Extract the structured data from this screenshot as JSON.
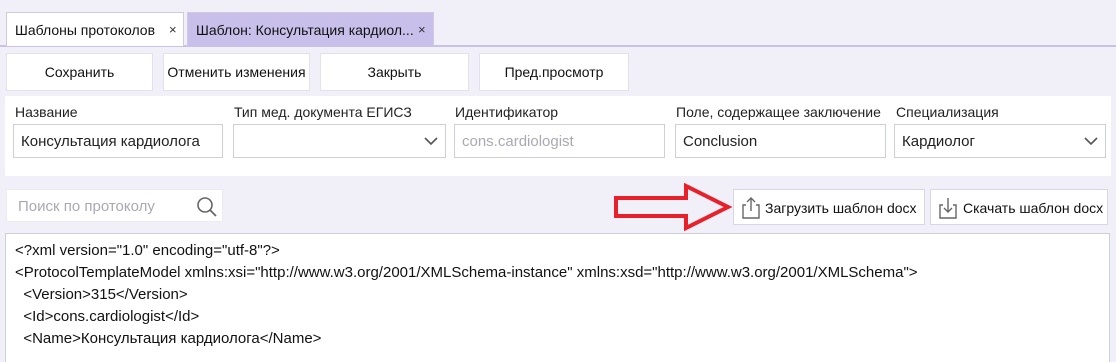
{
  "tabs": [
    {
      "label": "Шаблоны протоколов",
      "close": "×"
    },
    {
      "label": "Шаблон: Консультация кардиол...",
      "close": "×"
    }
  ],
  "toolbar": {
    "save": "Сохранить",
    "revert": "Отменить изменения",
    "close": "Закрыть",
    "preview": "Пред.просмотр"
  },
  "form": {
    "name": {
      "label": "Название",
      "value": "Консультация кардиолога"
    },
    "doc_type": {
      "label": "Тип мед. документа ЕГИСЗ",
      "value": ""
    },
    "identifier": {
      "label": "Идентификатор",
      "placeholder": "cons.cardiologist"
    },
    "conclusion_field": {
      "label": "Поле, содержащее заключение",
      "value": "Conclusion"
    },
    "specialization": {
      "label": "Специализация",
      "value": "Кардиолог"
    }
  },
  "search": {
    "placeholder": "Поиск по протоколу"
  },
  "actions": {
    "upload": "Загрузить шаблон docx",
    "download": "Скачать шаблон docx"
  },
  "annotation_color": "#e8202a",
  "editor": {
    "lines": [
      "<?xml version=\"1.0\" encoding=\"utf-8\"?>",
      "<ProtocolTemplateModel xmlns:xsi=\"http://www.w3.org/2001/XMLSchema-instance\" xmlns:xsd=\"http://www.w3.org/2001/XMLSchema\">",
      "  <Version>315</Version>",
      "  <Id>cons.cardiologist</Id>",
      "  <Name>Консультация кардиолога</Name>"
    ]
  }
}
